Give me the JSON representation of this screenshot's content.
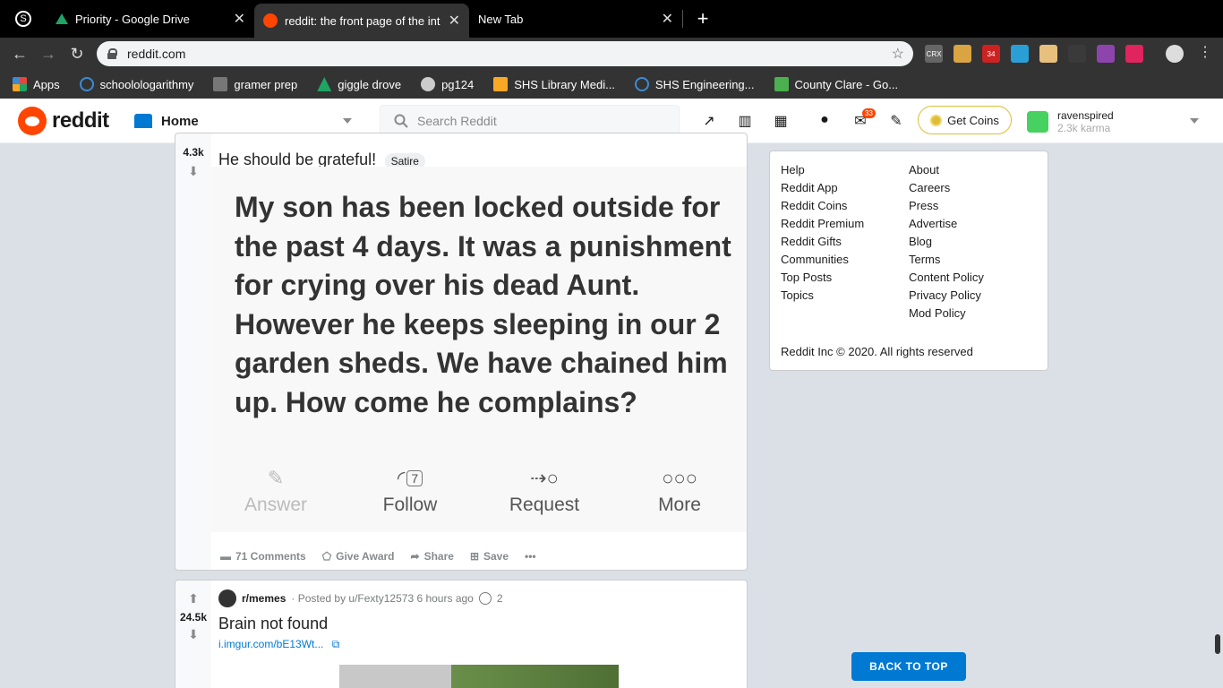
{
  "browser": {
    "tabs": [
      {
        "title": "Priority - Google Drive",
        "active": false
      },
      {
        "title": "reddit: the front page of the int",
        "active": true
      },
      {
        "title": "New Tab",
        "active": false
      }
    ],
    "url": "reddit.com",
    "extensions": [
      {
        "label": "CRX",
        "color": "#666666"
      },
      {
        "label": "",
        "color": "#d9a441"
      },
      {
        "label": "34",
        "color": "#cc2222"
      },
      {
        "label": "",
        "color": "#2a9fd6"
      },
      {
        "label": "",
        "color": "#e8c07d"
      },
      {
        "label": "",
        "color": "#3a3a3a"
      },
      {
        "label": "",
        "color": "#8e44ad"
      },
      {
        "label": "",
        "color": "#e0245e"
      }
    ],
    "bookmarks": [
      {
        "label": "Apps",
        "color": "#e8453c"
      },
      {
        "label": "schoolologarithmy",
        "color": "#3d8bd4"
      },
      {
        "label": "gramer prep",
        "color": "#777777"
      },
      {
        "label": "giggle drove",
        "color": "#1fa463"
      },
      {
        "label": "pg124",
        "color": "#cccccc"
      },
      {
        "label": "SHS Library Medi...",
        "color": "#f9a825"
      },
      {
        "label": "SHS Engineering...",
        "color": "#3d8bd4"
      },
      {
        "label": "County Clare - Go...",
        "color": "#4caf50"
      }
    ]
  },
  "header": {
    "logo_text": "reddit",
    "home_label": "Home",
    "search_placeholder": "Search Reddit",
    "mail_badge": "33",
    "coins_label": "Get Coins",
    "username": "ravenspired",
    "karma": "2.3k karma"
  },
  "posts": [
    {
      "votes": "4.3k",
      "title": "He should be grateful!",
      "flair": "Satire",
      "image_text": "My son has been locked outside for the past 4 days. It was a punishment for crying over his dead Aunt. However he keeps sleeping in our 2 garden sheds. We have chained him up. How come he complains?",
      "image_actions": [
        {
          "label": "Answer",
          "icon": "pencil-icon"
        },
        {
          "label": "Follow",
          "icon": "rss-icon",
          "count": "7"
        },
        {
          "label": "Request",
          "icon": "person-add-icon"
        },
        {
          "label": "More",
          "icon": "dots-icon"
        }
      ],
      "actions": {
        "comments": "71 Comments",
        "award": "Give Award",
        "share": "Share",
        "save": "Save",
        "more": "•••"
      }
    },
    {
      "votes": "24.5k",
      "subreddit": "r/memes",
      "posted_by": "· Posted by u/Fexty12573 6 hours ago",
      "award_count": "2",
      "title": "Brain not found",
      "link": "i.imgur.com/bE13Wt..."
    }
  ],
  "sidebar": {
    "col1": [
      "Help",
      "Reddit App",
      "Reddit Coins",
      "Reddit Premium",
      "Reddit Gifts",
      "Communities",
      "Top Posts",
      "Topics"
    ],
    "col2": [
      "About",
      "Careers",
      "Press",
      "Advertise",
      "Blog",
      "Terms",
      "Content Policy",
      "Privacy Policy",
      "Mod Policy"
    ],
    "copyright": "Reddit Inc © 2020. All rights reserved"
  },
  "back_to_top": "BACK TO TOP",
  "colors": {
    "accent": "#0079d3",
    "reddit_orange": "#ff4500",
    "background": "#dae0e6"
  }
}
